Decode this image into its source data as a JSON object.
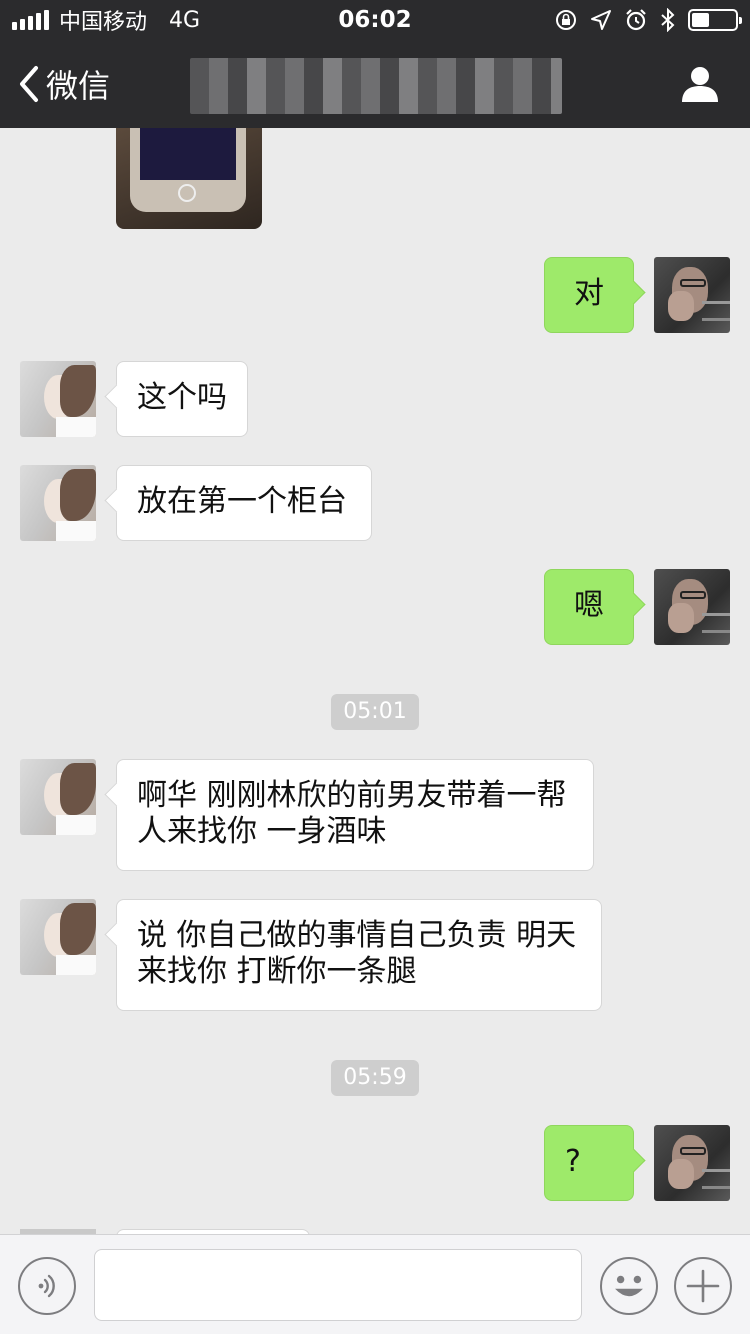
{
  "status_bar": {
    "carrier": "中国移动",
    "network": "4G",
    "time": "06:02",
    "battery_level": 0.4
  },
  "nav": {
    "back_label": "微信",
    "title": "",
    "profile_icon": "person-icon"
  },
  "messages": [
    {
      "type": "image",
      "side": "left",
      "description_icon": "photo-icon"
    },
    {
      "type": "text",
      "side": "right",
      "text": "对"
    },
    {
      "type": "text",
      "side": "left",
      "text": "这个吗"
    },
    {
      "type": "text",
      "side": "left",
      "text": "放在第一个柜台"
    },
    {
      "type": "text",
      "side": "right",
      "text": "嗯"
    },
    {
      "type": "time",
      "text": "05:01"
    },
    {
      "type": "text",
      "side": "left",
      "text": "啊华 刚刚林欣的前男友带着一帮人来找你 一身酒味"
    },
    {
      "type": "text",
      "side": "left",
      "text": "说 你自己做的事情自己负责 明天来找你 打断你一条腿"
    },
    {
      "type": "time",
      "text": "05:59"
    },
    {
      "type": "text",
      "side": "right",
      "text": "?"
    }
  ],
  "input_bar": {
    "voice_icon": "voice-icon",
    "input_value": "",
    "emoji_icon": "emoji-icon",
    "plus_icon": "plus-icon"
  },
  "colors": {
    "bar_background": "#2b2b2d",
    "chat_background": "#ebebeb",
    "sent_bubble": "#9eea6a",
    "received_bubble": "#ffffff",
    "timestamp_background": "#cecece"
  }
}
